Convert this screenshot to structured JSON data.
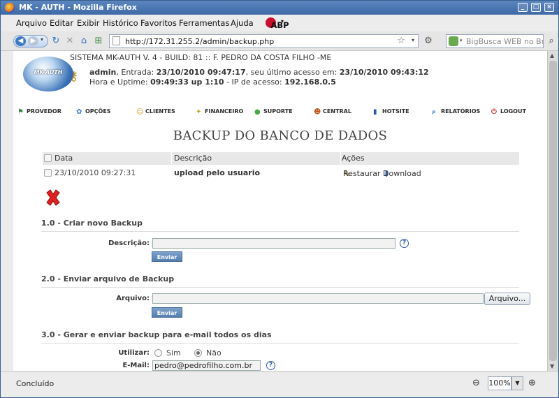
{
  "window": {
    "title": "MK - AUTH - Mozilla Firefox",
    "controls": [
      "_",
      "□",
      "×"
    ]
  },
  "menubar": {
    "items": [
      "Arquivo",
      "Editar",
      "Exibir",
      "Histórico",
      "Favoritos",
      "Ferramentas",
      "Ajuda"
    ]
  },
  "navbar": {
    "url": "http://172.31.255.2/admin/backup.php",
    "search_placeholder": "BigBusca WEB no Brasil",
    "adblock_label": "ABP"
  },
  "header": {
    "logo_text": "MK-AUTH",
    "system_line": "SISTEMA MK-AUTH V. 4 - BUILD: 81 :: F. PEDRO DA COSTA FILHO -ME",
    "user": "admin",
    "entrada_label": ", Entrada: ",
    "entrada_value": "23/10/2010 09:47:17",
    "ultimo_label": ", seu último acesso em: ",
    "ultimo_value": "23/10/2010 09:43:12",
    "uptime_label": "Hora e Uptime: ",
    "uptime_value": "09:49:33 up 1:10",
    "ip_label": " - IP de acesso: ",
    "ip_value": "192.168.0.5"
  },
  "main_menu": {
    "items": [
      {
        "label": "PROVEDOR",
        "icon": "flag-icon",
        "color": "#2e8b3a"
      },
      {
        "label": "OPÇÕES",
        "icon": "options-icon",
        "color": "#3a7bd5"
      },
      {
        "label": "CLIENTES",
        "icon": "user-icon",
        "color": "#d99a1a"
      },
      {
        "label": "FINANCEIRO",
        "icon": "finance-icon",
        "color": "#c8a21c"
      },
      {
        "label": "SUPORTE",
        "icon": "speech-bubble-icon",
        "color": "#4aa84a"
      },
      {
        "label": "CENTRAL",
        "icon": "central-user-icon",
        "color": "#c05a1a"
      },
      {
        "label": "HOTSITE",
        "icon": "chart-icon",
        "color": "#2a5ab0"
      },
      {
        "label": "RELATÓRIOS",
        "icon": "report-icon",
        "color": "#3a6ab0"
      },
      {
        "label": "LOGOUT",
        "icon": "logout-icon",
        "color": "#d02a2a"
      }
    ]
  },
  "page": {
    "title": "BACKUP DO BANCO DE DADOS",
    "table": {
      "headers": [
        "Data",
        "Descrição",
        "Ações"
      ],
      "rows": [
        {
          "date": "23/10/2010 09:27:31",
          "description": "upload pelo usuario",
          "restore": "Restaurar",
          "download": "Download"
        }
      ]
    },
    "section1": {
      "title": "1.0 - Criar novo Backup",
      "field_label": "Descrição:",
      "field_value": "",
      "button": "Enviar"
    },
    "section2": {
      "title": "2.0 - Enviar arquivo de Backup",
      "field_label": "Arquivo:",
      "field_value": "",
      "browse_button": "Arquivo...",
      "button": "Enviar"
    },
    "section3": {
      "title": "3.0 - Gerar e enviar backup para e-mail todos os dias",
      "use_label": "Utilizar:",
      "option_yes": "Sim",
      "option_no": "Não",
      "selected": "Não",
      "email_label": "E-Mail:",
      "email_value": "pedro@pedrofilho.com.br"
    }
  },
  "status": {
    "text": "Concluído",
    "zoom": "100%"
  }
}
